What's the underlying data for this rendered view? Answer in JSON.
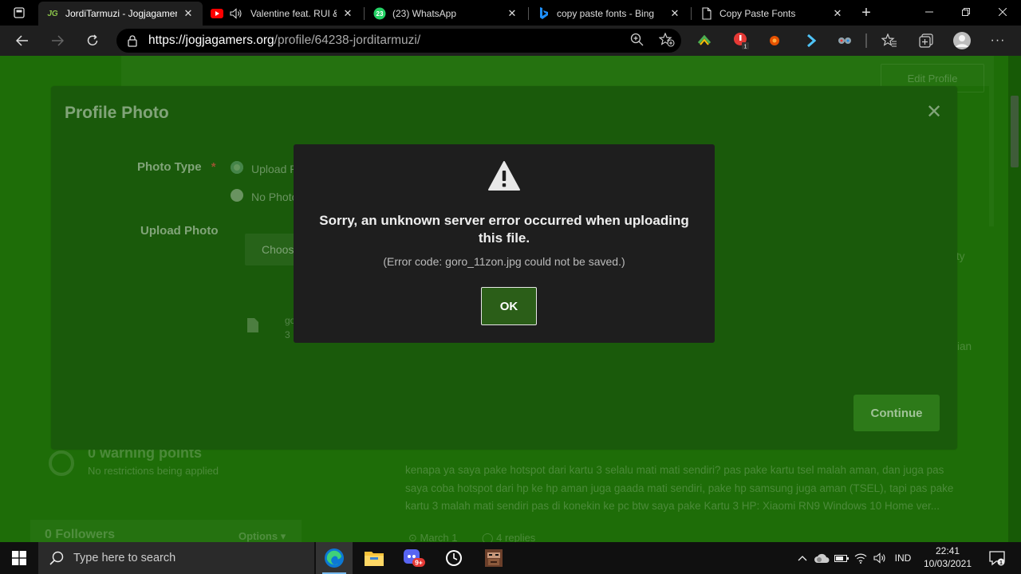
{
  "browser": {
    "tabs": [
      {
        "title": "JordiTarmuzi - Jogjagamer",
        "favicon": "jg-logo-icon",
        "active": true
      },
      {
        "title": "Valentine feat. RUI &",
        "favicon": "youtube-icon",
        "active": false
      },
      {
        "title": "(23) WhatsApp",
        "favicon": "whatsapp-icon",
        "badge": "23",
        "active": false
      },
      {
        "title": "copy paste fonts - Bing",
        "favicon": "bing-icon",
        "active": false
      },
      {
        "title": "Copy Paste Fonts",
        "favicon": "page-icon",
        "active": false
      }
    ],
    "url_host": "https://jogjagamers.org",
    "url_path": "/profile/64238-jorditarmuzi/",
    "extension_badge": "1"
  },
  "page": {
    "edit_profile_label": "Edit Profile",
    "warning_heading": "0 warning points",
    "warning_sub": "No restrictions being applied",
    "followers_heading": "0 Followers",
    "options_label": "Options ▾",
    "post_lines": [
      "kenapa ya saya pake hotspot dari kartu 3 selalu mati mati sendiri? pas pake kartu tsel malah aman, dan juga pas",
      "saya coba hotspot dari hp ke hp aman juga gaada mati sendiri, pake hp samsung juga aman (TSEL), tapi pas pake",
      "kartu 3 malah mati sendiri pas di konekin ke pc btw saya pake Kartu 3 HP: Xiaomi RN9 Windows 10 Home ver..."
    ],
    "post_meta": [
      "March 1",
      "4 replies"
    ],
    "side_fragment_1": "ity",
    "side_fragment_2": "ian"
  },
  "profile_modal": {
    "title": "Profile Photo",
    "photo_type_label": "Photo Type",
    "required_mark": "*",
    "option_upload": "Upload P",
    "option_none": "No Photo",
    "upload_photo_label": "Upload Photo",
    "choose_label": "Choos",
    "file_line_1": "go",
    "file_line_2": "3",
    "continue_label": "Continue"
  },
  "error_dialog": {
    "message": "Sorry, an unknown server error occurred when uploading this file.",
    "code": "(Error code: goro_11zon.jpg could not be saved.)",
    "ok_label": "OK",
    "icon": "warning-icon"
  },
  "taskbar": {
    "search_placeholder": "Type here to search",
    "apps": [
      "edge-icon",
      "file-explorer-icon",
      "discord-icon",
      "clock-app-icon",
      "game-icon"
    ],
    "discord_badge": "9+",
    "language": "IND",
    "time": "22:41",
    "date": "10/03/2021",
    "notification_count": "1"
  },
  "colors": {
    "page_green": "#1e6d08",
    "modal_green": "#1a5a0b",
    "dialog_bg": "#1e1e1e",
    "ok_button": "#2b5e18"
  }
}
